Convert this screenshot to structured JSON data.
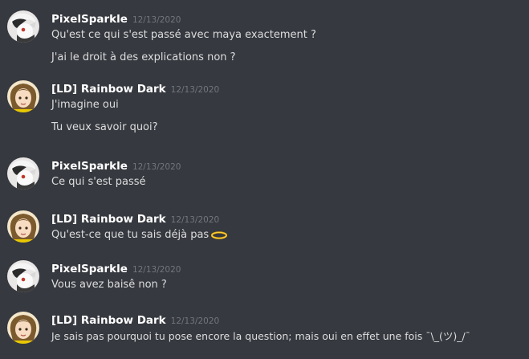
{
  "users": {
    "pixel": {
      "name": "PixelSparkle"
    },
    "rainbow": {
      "name": "[LD] Rainbow Dark"
    }
  },
  "messages": [
    {
      "author": "PixelSparkle",
      "timestamp": "12/13/2020",
      "lines": [
        "Qu'est ce qui s'est passé avec maya exactement ?",
        "J'ai le droit à des explications non ?"
      ]
    },
    {
      "author": "[LD] Rainbow Dark",
      "timestamp": "12/13/2020",
      "lines": [
        "J'imagine oui",
        "Tu veux savoir quoi?"
      ]
    },
    {
      "author": "PixelSparkle",
      "timestamp": "12/13/2020",
      "lines": [
        "Ce qui s'est passé"
      ]
    },
    {
      "author": "[LD] Rainbow Dark",
      "timestamp": "12/13/2020",
      "lines": [
        "Qu'est-ce que tu sais déjà pas"
      ],
      "emoji": "ring-icon"
    },
    {
      "author": "PixelSparkle",
      "timestamp": "12/13/2020",
      "lines": [
        "Vous avez baisê non ?"
      ]
    },
    {
      "author": "[LD] Rainbow Dark",
      "timestamp": "12/13/2020",
      "lines": [
        "Je sais pas pourquoi tu pose encore la question; mais oui en effet une fois ¯\\_(ツ)_/¯"
      ]
    }
  ],
  "colors": {
    "background": "#36393f",
    "username": "#ffffff",
    "timestamp": "#72767d",
    "text": "#dcddde"
  }
}
